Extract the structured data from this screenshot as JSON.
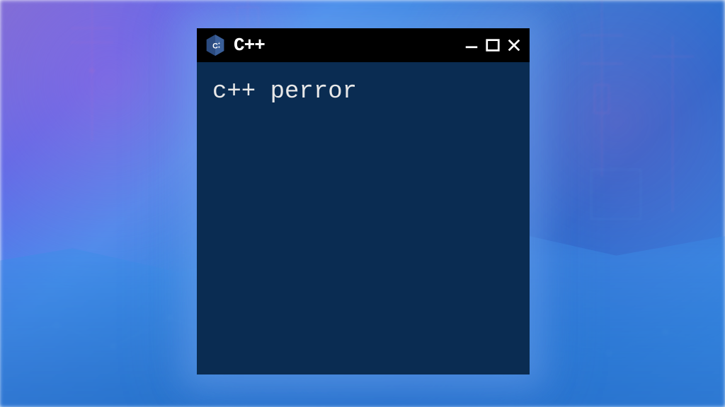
{
  "window": {
    "title": "C++",
    "icon_name": "cpp-icon"
  },
  "terminal": {
    "content": "c++ perror"
  },
  "colors": {
    "terminal_bg": "#0a2c52",
    "titlebar_bg": "#000000",
    "text": "#e8e8e8"
  }
}
